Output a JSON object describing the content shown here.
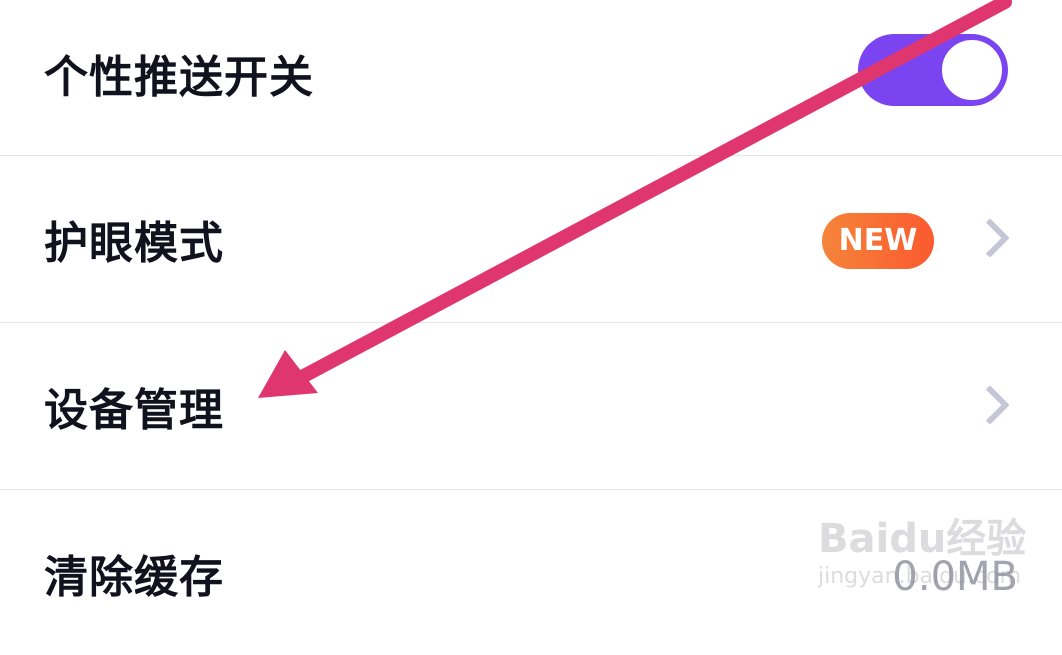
{
  "settings": {
    "items": [
      {
        "label": "个性推送开关",
        "control": "toggle",
        "toggle_on": true
      },
      {
        "label": "护眼模式",
        "control": "chevron",
        "badge": "NEW"
      },
      {
        "label": "设备管理",
        "control": "chevron"
      },
      {
        "label": "清除缓存",
        "value": "0.0MB"
      }
    ]
  },
  "watermark": {
    "logo": "Baidu经验",
    "sub": "jingyan.baidu.com"
  },
  "colors": {
    "accent": "#7a44f0",
    "badge": "#fb6a32",
    "annotation_arrow": "#e0366f"
  }
}
